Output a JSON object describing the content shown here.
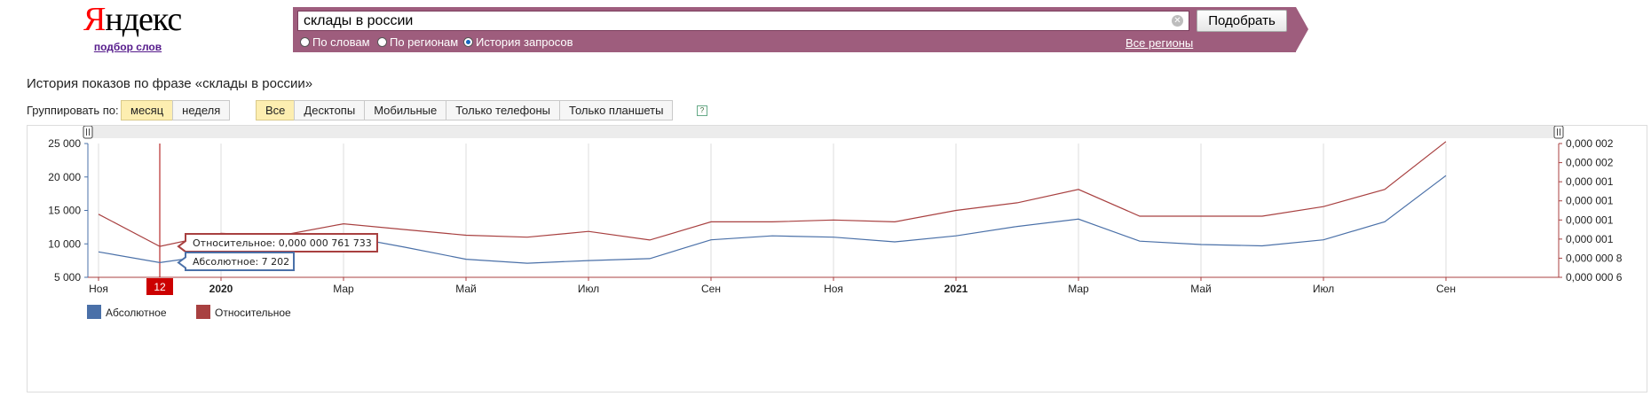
{
  "header": {
    "logo": "Яндекс",
    "logo_subtitle": "подбор слов"
  },
  "search": {
    "query": "склады в россии",
    "submit_label": "Подобрать",
    "modes": [
      {
        "label": "По словам",
        "selected": false
      },
      {
        "label": "По регионам",
        "selected": false
      },
      {
        "label": "История запросов",
        "selected": true
      }
    ],
    "regions_link": "Все регионы"
  },
  "page_title": "История показов по фразе «склады в россии»",
  "grouping": {
    "label": "Группировать по:",
    "options": [
      {
        "label": "месяц",
        "selected": true
      },
      {
        "label": "неделя",
        "selected": false
      }
    ]
  },
  "devices": {
    "options": [
      {
        "label": "Все",
        "selected": true
      },
      {
        "label": "Десктопы",
        "selected": false
      },
      {
        "label": "Мобильные",
        "selected": false
      },
      {
        "label": "Только телефоны",
        "selected": false
      },
      {
        "label": "Только планшеты",
        "selected": false
      }
    ],
    "help": "?"
  },
  "chart_data": {
    "type": "line",
    "x": [
      "2019-11",
      "2019-12",
      "2020-01",
      "2020-02",
      "2020-03",
      "2020-04",
      "2020-05",
      "2020-06",
      "2020-07",
      "2020-08",
      "2020-09",
      "2020-10",
      "2020-11",
      "2020-12",
      "2021-01",
      "2021-02",
      "2021-03",
      "2021-04",
      "2021-05",
      "2021-06",
      "2021-07",
      "2021-08",
      "2021-09",
      "2021-10"
    ],
    "x_tick_labels": [
      {
        "x": "2019-11",
        "label": "Ноя",
        "bold": false
      },
      {
        "x": "2020-01",
        "label": "2020",
        "bold": true
      },
      {
        "x": "2020-03",
        "label": "Мар",
        "bold": false
      },
      {
        "x": "2020-05",
        "label": "Май",
        "bold": false
      },
      {
        "x": "2020-07",
        "label": "Июл",
        "bold": false
      },
      {
        "x": "2020-09",
        "label": "Сен",
        "bold": false
      },
      {
        "x": "2020-11",
        "label": "Ноя",
        "bold": false
      },
      {
        "x": "2021-01",
        "label": "2021",
        "bold": true
      },
      {
        "x": "2021-03",
        "label": "Мар",
        "bold": false
      },
      {
        "x": "2021-05",
        "label": "Май",
        "bold": false
      },
      {
        "x": "2021-07",
        "label": "Июл",
        "bold": false
      },
      {
        "x": "2021-09",
        "label": "Сен",
        "bold": false
      }
    ],
    "series": [
      {
        "name": "Абсолютное",
        "color": "#4a70a8",
        "axis": "left",
        "values": [
          8800,
          7202,
          8500,
          8400,
          11200,
          9500,
          7700,
          7100,
          7500,
          7800,
          10600,
          11200,
          11000,
          10300,
          11200,
          12600,
          13700,
          10400,
          9900,
          9700,
          10600,
          13300,
          20200
        ]
      },
      {
        "name": "Относительное",
        "color": "#a84040",
        "axis": "right",
        "values": [
          9.3e-07,
          7.61733e-07,
          8.3e-07,
          8.2e-07,
          8.8e-07,
          8.5e-07,
          8.2e-07,
          8.1e-07,
          8.4e-07,
          7.95e-07,
          8.9e-07,
          8.9e-07,
          9e-07,
          8.9e-07,
          9.5e-07,
          9.9e-07,
          1.06e-06,
          9.2e-07,
          9.2e-07,
          9.2e-07,
          9.7e-07,
          1.06e-06,
          1.31e-06
        ]
      }
    ],
    "y_left": {
      "ticks": [
        "5 000",
        "10 000",
        "15 000",
        "20 000",
        "25 000"
      ],
      "range": [
        5000,
        25000
      ]
    },
    "y_right": {
      "ticks": [
        "0,000 000 6",
        "0,000 000 8",
        "0,000 001",
        "0,000 001",
        "0,000 001",
        "0,000 001",
        "0,000 002",
        "0,000 002"
      ],
      "range": [
        6e-07,
        1.3e-06
      ]
    },
    "grid": true,
    "legend_position": "bottom-left",
    "highlight": {
      "x": "2019-12",
      "marker_label": "12",
      "tooltip_relative": "Относительное: 0,000 000 761 733",
      "tooltip_absolute": "Абсолютное: 7 202"
    }
  }
}
